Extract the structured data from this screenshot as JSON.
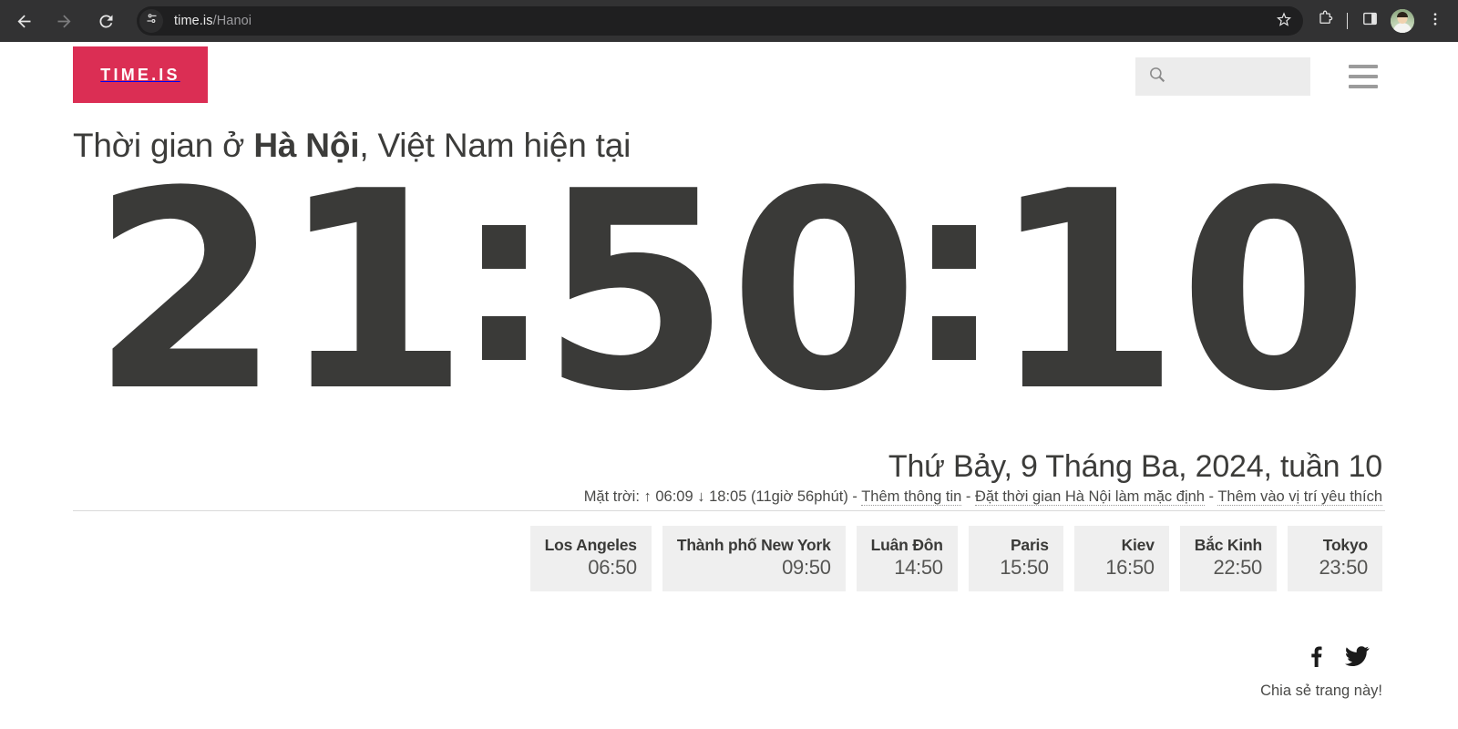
{
  "browser": {
    "back_label": "Back",
    "forward_label": "Forward",
    "reload_label": "Reload",
    "url_domain": "time.is",
    "url_path": "/Hanoi",
    "site_info_icon": "tune-sliders-icon",
    "bookmark_icon": "star-icon",
    "extensions_icon": "puzzle-piece-icon",
    "side_panel_icon": "side-panel-icon",
    "profile_icon": "avatar",
    "menu_icon": "three-dot-menu-icon",
    "toolbar_bg": "#323233",
    "omnibox_bg": "#1f1f20"
  },
  "site": {
    "logo_text": "TIME.IS",
    "logo_color": "#db2e54",
    "search_placeholder": "",
    "search_value": "",
    "search_icon": "magnifier-icon",
    "menu_icon": "hamburger-menu-icon"
  },
  "headline": {
    "prefix": "Thời gian ở ",
    "city": "Hà Nội",
    "suffix": ", Việt Nam hiện tại"
  },
  "clock": {
    "hours": "21",
    "minutes": "50",
    "seconds": "10",
    "color": "#3a3a38"
  },
  "date_line": "Thứ Bảy, 9 Tháng Ba, 2024, tuần 10",
  "info_line": {
    "sun_label": "Mặt trời:",
    "sunrise_arrow": "↑",
    "sunrise": "06:09",
    "sunset_arrow": "↓",
    "sunset": "18:05",
    "daylength": "(11giờ 56phút)",
    "sep": " - ",
    "link_more_info": "Thêm thông tin",
    "link_set_default": "Đặt thời gian Hà Nội làm mặc định",
    "link_add_favorite": "Thêm vào vị trí yêu thích"
  },
  "cities": [
    {
      "name": "Los Angeles",
      "time": "06:50"
    },
    {
      "name": "Thành phố New York",
      "time": "09:50"
    },
    {
      "name": "Luân Đôn",
      "time": "14:50"
    },
    {
      "name": "Paris",
      "time": "15:50"
    },
    {
      "name": "Kiev",
      "time": "16:50"
    },
    {
      "name": "Bắc Kinh",
      "time": "22:50"
    },
    {
      "name": "Tokyo",
      "time": "23:50"
    }
  ],
  "share": {
    "caption": "Chia sẻ trang này!",
    "facebook_icon": "facebook-icon",
    "twitter_icon": "twitter-bird-icon"
  }
}
